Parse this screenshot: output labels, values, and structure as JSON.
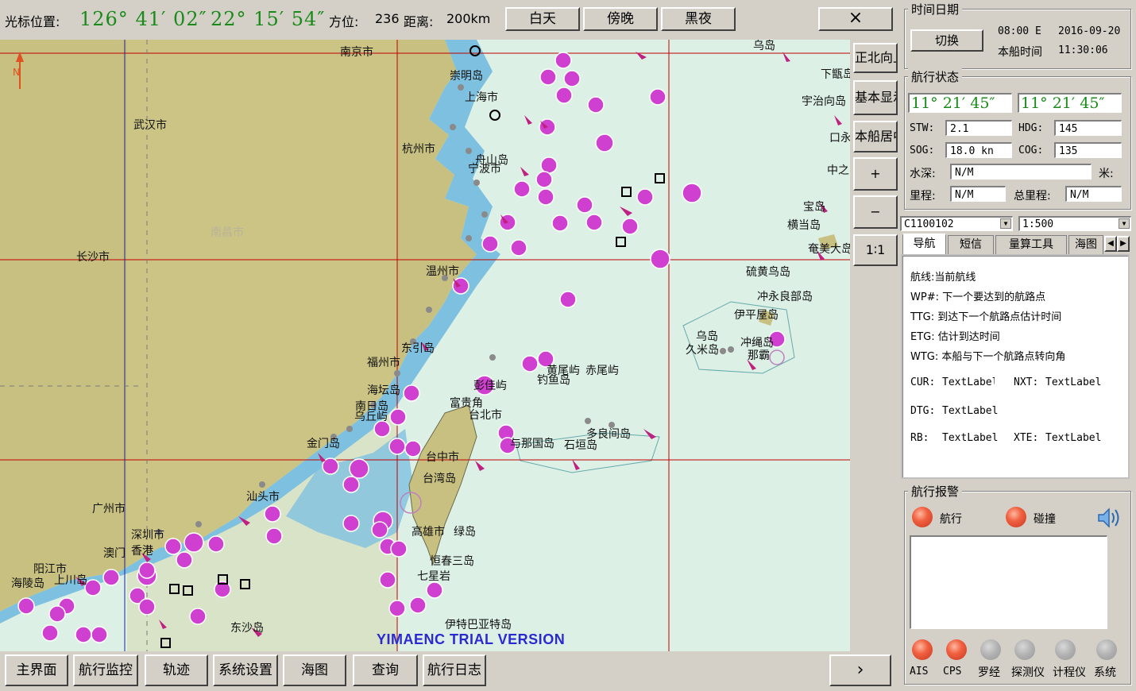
{
  "topbar": {
    "cursor_label": "光标位置:",
    "cursor_lon": "126° 41′ 02″",
    "cursor_lat": "22° 15′ 54″",
    "bearing_label": "方位:",
    "bearing_value": "236",
    "distance_label": "距离:",
    "distance_value": "200km",
    "day_button": "白天",
    "dusk_button": "傍晚",
    "night_button": "黑夜",
    "close_button": "×"
  },
  "map_side": {
    "north_up": "正北向上",
    "basic_display": "基本显示",
    "center_ship": "本船居中",
    "zoom_in": "+",
    "zoom_out": "−",
    "scale_1_1": "1∶1"
  },
  "map": {
    "north_label": "N",
    "trial_text": "YIMAENC TRIAL VERSION",
    "places": [
      "南京市",
      "崇明岛",
      "上海市",
      "武汉市",
      "杭州市",
      "舟山岛",
      "宁波市",
      "南昌市",
      "长沙市",
      "温州市",
      "东引岛",
      "福州市",
      "海坛岛",
      "南日岛",
      "乌丘屿",
      "金门岛",
      "汕头市",
      "广州市",
      "深圳市",
      "香港",
      "澳门",
      "阳江市",
      "上川岛",
      "海陵岛",
      "东沙岛",
      "台中市",
      "台湾岛",
      "富贵角",
      "台北市",
      "高雄市",
      "绿岛",
      "恒春三岛",
      "七星岩",
      "伊特巴亚特岛",
      "彭佳屿",
      "黄尾屿",
      "赤尾屿",
      "钓鱼岛",
      "与那国岛",
      "石垣岛",
      "多良间岛",
      "乌岛",
      "久米岛",
      "冲绳岛",
      "那霸",
      "伊平屋岛",
      "冲永良部岛",
      "硫黄鸟岛",
      "横当岛",
      "宝岛",
      "奄美大岛",
      "中之岛",
      "口永良部岛",
      "宇治向岛",
      "下甑岛",
      "乌岛"
    ]
  },
  "datetime": {
    "group_title": "时间日期",
    "switch_button": "切换",
    "utc_time": "08:00 E",
    "date": "2016-09-20",
    "ship_time_label": "本船时间",
    "ship_time": "11:30:06"
  },
  "nav_status": {
    "group_title": "航行状态",
    "lat": "11° 21′ 45″",
    "lon": "11° 21′ 45″",
    "stw_label": "STW:",
    "stw": "2.1",
    "hdg_label": "HDG:",
    "hdg": "145",
    "sog_label": "SOG:",
    "sog": "18.0 kn",
    "cog_label": "COG:",
    "cog": "135",
    "depth_label": "水深:",
    "depth": "N/M",
    "depth_unit": "米:",
    "mileage_label": "里程:",
    "mileage": "N/M",
    "total_mileage_label": "总里程:",
    "total_mileage": "N/M"
  },
  "selectors": {
    "chart_id": "C1100102",
    "scale": "1:500"
  },
  "tabs": [
    "导航",
    "短信",
    "量算工具",
    "海图"
  ],
  "nav_panel": {
    "route": "航线:当前航线",
    "wp": "WP#: 下一个要达到的航路点",
    "ttg": "TTG: 到达下一个航路点估计时间",
    "etg": "ETG: 估计到达时间",
    "wtg": "WTG: 本船与下一个航路点转向角",
    "cur_label": "CUR:",
    "cur_value": "TextLabel",
    "nxt_label": "NXT:",
    "nxt_value": "TextLabel",
    "dtg_label": "DTG:",
    "dtg_value": "TextLabel",
    "rb_label": "RB:",
    "rb_value": "TextLabel",
    "xte_label": "XTE:",
    "xte_value": "TextLabel"
  },
  "alarm": {
    "group_title": "航行报警",
    "nav_label": "航行",
    "collision_label": "碰撞",
    "sensors": [
      "AIS",
      "CPS",
      "罗经",
      "探测仪",
      "计程仪",
      "系统"
    ]
  },
  "bottom": {
    "main": "主界面",
    "monitor": "航行监控",
    "track": "轨迹",
    "settings": "系统设置",
    "chart": "海图",
    "query": "查询",
    "log": "航行日志",
    "next": "›"
  },
  "colors": {
    "land": "#c8c080",
    "water_shallow": "#7ec0e0",
    "sea": "#dcf0e6",
    "magenta": "#d040d0",
    "grid": "#c00000",
    "coord_green": "#1a8a1a"
  }
}
